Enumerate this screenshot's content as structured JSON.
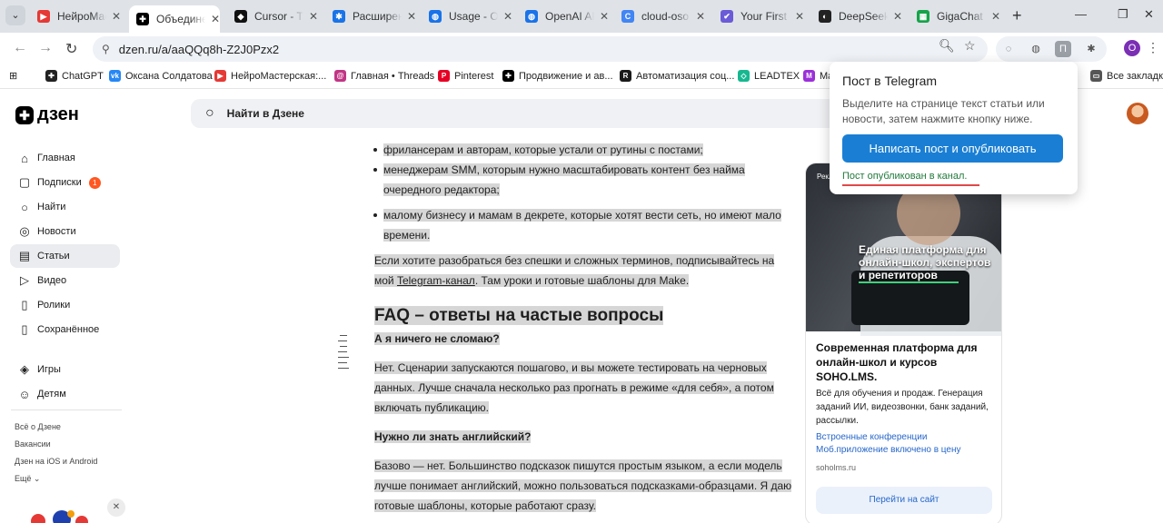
{
  "tabs": [
    {
      "title": "НейроМастерская",
      "favicon_color": "#e53935",
      "favicon_glyph": "▶"
    },
    {
      "title": "Объединение",
      "favicon_color": "#000000",
      "favicon_glyph": "✚"
    },
    {
      "title": "Cursor - The",
      "favicon_color": "#111111",
      "favicon_glyph": "◆"
    },
    {
      "title": "Расширения",
      "favicon_color": "#1a73e8",
      "favicon_glyph": "✱"
    },
    {
      "title": "Usage - OpenAI",
      "favicon_color": "#1a73e8",
      "favicon_glyph": "◍"
    },
    {
      "title": "OpenAI API",
      "favicon_color": "#1a73e8",
      "favicon_glyph": "◍"
    },
    {
      "title": "cloud-oso",
      "favicon_color": "#4285f4",
      "favicon_glyph": "C"
    },
    {
      "title": "Your First",
      "favicon_color": "#6b5bd6",
      "favicon_glyph": "✔"
    },
    {
      "title": "DeepSeek",
      "favicon_color": "#222222",
      "favicon_glyph": "◐"
    },
    {
      "title": "GigaChat",
      "favicon_color": "#16a34a",
      "favicon_glyph": "▦"
    }
  ],
  "toolbar": {
    "url": "dzen.ru/a/aaQQq8h-Z2J0Pzx2"
  },
  "bookmarks": [
    {
      "label": "ChatGPT",
      "favicon_color": "#222222",
      "favicon_glyph": "✚"
    },
    {
      "label": "Оксана Солдатова",
      "favicon_color": "#2787f5",
      "favicon_glyph": "vk"
    },
    {
      "label": "НейроМастерская:...",
      "favicon_color": "#e53935",
      "favicon_glyph": "▶"
    },
    {
      "label": "Главная • Threads",
      "favicon_color": "#c13584",
      "favicon_glyph": "@"
    },
    {
      "label": "Pinterest",
      "favicon_color": "#e60023",
      "favicon_glyph": "P"
    },
    {
      "label": "Продвижение и ав...",
      "favicon_color": "#000000",
      "favicon_glyph": "✚"
    },
    {
      "label": "Автоматизация соц...",
      "favicon_color": "#1a1a1a",
      "favicon_glyph": "R"
    },
    {
      "label": "LEADTEX",
      "favicon_color": "#17b890",
      "favicon_glyph": "◇"
    },
    {
      "label": "Ma",
      "favicon_color": "#9b30d9",
      "favicon_glyph": "M"
    },
    {
      "label": "Все закладки",
      "favicon_color": "#555555",
      "favicon_glyph": "▭"
    }
  ],
  "header": {
    "logo": "дзен",
    "search_placeholder": "Найти в Дзене"
  },
  "sidebar": {
    "items": [
      {
        "label": "Главная",
        "icon": "home-icon",
        "glyph": "⌂"
      },
      {
        "label": "Подписки",
        "icon": "subscriptions-icon",
        "glyph": "▢",
        "badge": "1"
      },
      {
        "label": "Найти",
        "icon": "search-icon",
        "glyph": "○"
      },
      {
        "label": "Новости",
        "icon": "news-icon",
        "glyph": "◎"
      },
      {
        "label": "Статьи",
        "icon": "articles-icon",
        "glyph": "▤"
      },
      {
        "label": "Видео",
        "icon": "video-icon",
        "glyph": "▷"
      },
      {
        "label": "Ролики",
        "icon": "shorts-icon",
        "glyph": "▯"
      },
      {
        "label": "Сохранённое",
        "icon": "bookmark-icon",
        "glyph": "▯"
      }
    ],
    "items2": [
      {
        "label": "Игры",
        "icon": "games-icon",
        "glyph": "◈"
      },
      {
        "label": "Детям",
        "icon": "kids-icon",
        "glyph": "☺"
      }
    ],
    "links": [
      "Всё о Дзене",
      "Вакансии",
      "Дзен на iOS и Android",
      "Ещё ⌄"
    ]
  },
  "article": {
    "bullet1": "фрилансерам и авторам, которые устали от рутины с постами;",
    "bullet2": "менеджерам SMM, которым нужно масштабировать контент без найма очередного редактора;",
    "bullet3": "малому бизнесу и мамам в декрете, которые хотят вести сеть, но имеют мало времени.",
    "para1_start": "Если хотите разобраться без спешки и сложных терминов, подписывайтесь на мой ",
    "para1_link": "Telegram-канал",
    "para1_end": ". Там уроки и готовые шаблоны для Make.",
    "faq_heading": "FAQ – ответы на частые вопросы",
    "q1": "А я ничего не сломаю?",
    "a1": "Нет. Сценарии запускаются пошагово, и вы можете тестировать на черновых данных. Лучше сначала несколько раз прогнать в режиме «для себя», а потом включать публикацию.",
    "q2": "Нужно ли знать английский?",
    "a2": "Базово — нет. Большинство подсказок пишутся простым языком, а если модель лучше понимает английский, можно пользоваться подсказками-образцами. Я даю готовые шаблоны, которые работают сразу."
  },
  "ad": {
    "tag": "Рекл",
    "overlay": "Единая платформа для онлайн-школ, экспертов и репетиторов",
    "title": "Современная платформа для онлайн-школ и курсов SOHO.LMS.",
    "desc": "Всё для обучения и продаж. Генерация заданий ИИ, видеозвонки, банк заданий, рассылки.",
    "link1": "Встроенные конференции",
    "link2": "Моб.приложение включено в цену",
    "domain": "soholms.ru",
    "button": "Перейти на сайт"
  },
  "popup": {
    "title": "Пост в Telegram",
    "desc": "Выделите на странице текст статьи или новости, затем нажмите кнопку ниже.",
    "button": "Написать пост и опубликовать",
    "status": "Пост опубликован в канал."
  }
}
